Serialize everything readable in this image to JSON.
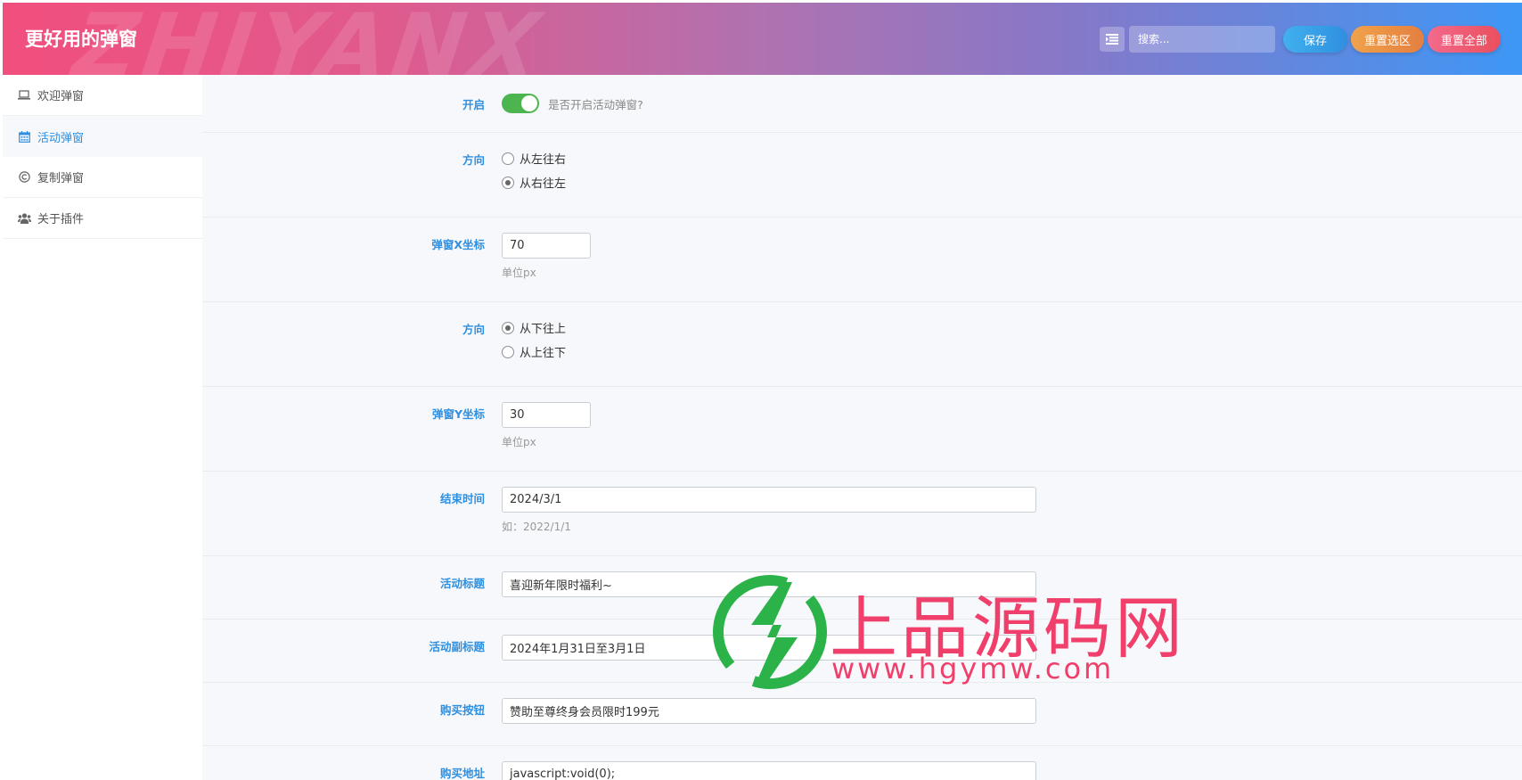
{
  "header": {
    "watermark": "ZHIYANX",
    "title": "更好用的弹窗",
    "search_placeholder": "搜索...",
    "save_label": "保存",
    "reset_section_label": "重置选区",
    "reset_all_label": "重置全部"
  },
  "sidebar": {
    "items": [
      {
        "label": "欢迎弹窗",
        "icon": "laptop-icon"
      },
      {
        "label": "活动弹窗",
        "icon": "calendar-icon"
      },
      {
        "label": "复制弹窗",
        "icon": "copyright-icon"
      },
      {
        "label": "关于插件",
        "icon": "users-icon"
      }
    ]
  },
  "form": {
    "enable": {
      "label": "开启",
      "hint": "是否开启活动弹窗?",
      "on": true
    },
    "direction_x": {
      "label": "方向",
      "options": [
        "从左往右",
        "从右往左"
      ],
      "selected": "从右往左"
    },
    "x_coord": {
      "label": "弹窗X坐标",
      "value": "70",
      "help": "单位px"
    },
    "direction_y": {
      "label": "方向",
      "options": [
        "从下往上",
        "从上往下"
      ],
      "selected": "从下往上"
    },
    "y_coord": {
      "label": "弹窗Y坐标",
      "value": "30",
      "help": "单位px"
    },
    "end_time": {
      "label": "结束时间",
      "value": "2024/3/1",
      "help": "如：2022/1/1"
    },
    "activity_title": {
      "label": "活动标题",
      "value": "喜迎新年限时福利~"
    },
    "activity_subtitle": {
      "label": "活动副标题",
      "value": "2024年1月31日至3月1日"
    },
    "buy_button": {
      "label": "购买按钮",
      "value": "赞助至尊终身会员限时199元"
    },
    "buy_url": {
      "label": "购买地址",
      "value": "javascript:void(0);"
    }
  },
  "overlay": {
    "brand_name": "上品源码网",
    "brand_url": "www.hgymw.com"
  },
  "colors": {
    "accent": "#2f8fe0",
    "toggle_on": "#4cb54f",
    "brand": "#ef3f6a",
    "brand_green": "#2bb34a"
  }
}
